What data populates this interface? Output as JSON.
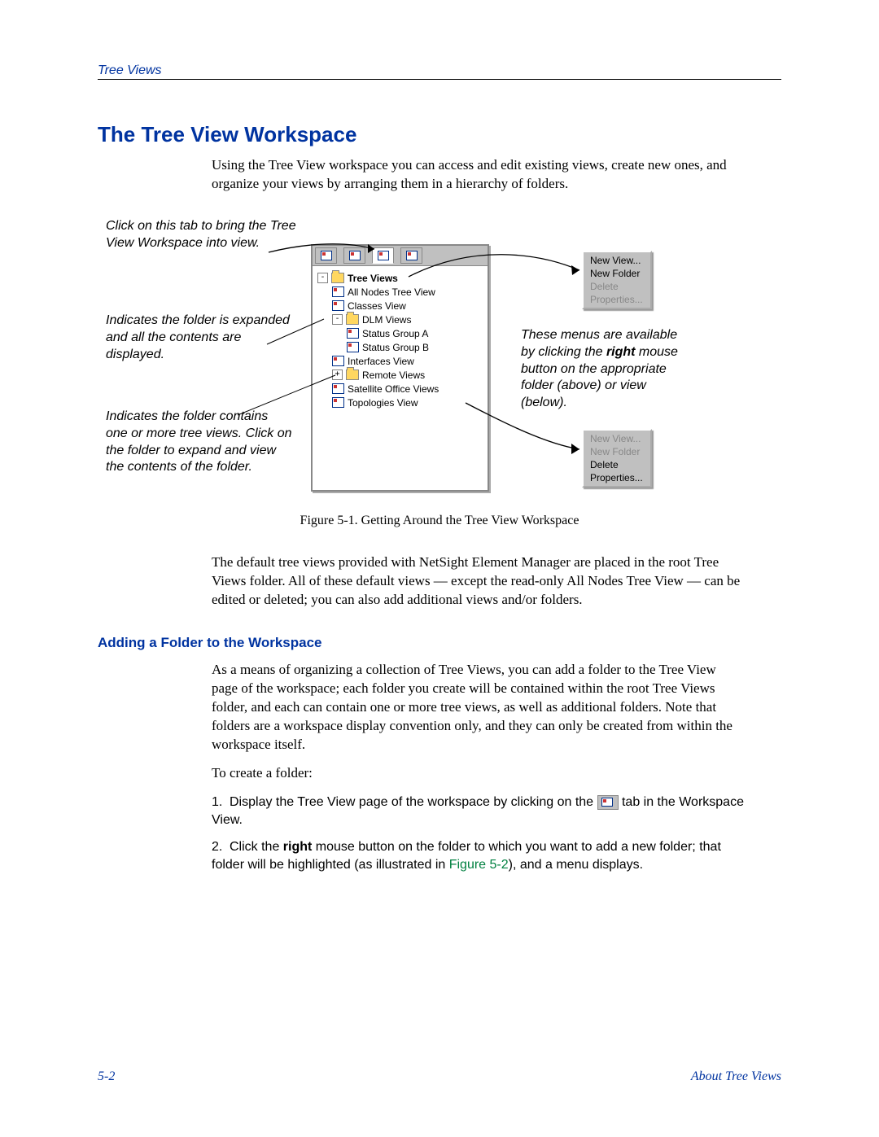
{
  "header": {
    "label": "Tree Views"
  },
  "title": "The Tree View Workspace",
  "intro": "Using the Tree View workspace you can access and edit existing views, create new ones, and organize your views by arranging them in a hierarchy of folders.",
  "notes": {
    "left1": "Click on this tab to bring the Tree View Workspace into view.",
    "left2": "Indicates the folder is expanded and all the contents are displayed.",
    "left3": "Indicates the folder contains one or more tree views. Click on the folder to expand and view the contents of the folder.",
    "right1_a": "These menus are available by clicking the ",
    "right1_bold": "right",
    "right1_b": " mouse button on the appropriate folder (above) or view (below)."
  },
  "tree": {
    "root": "Tree Views",
    "items": [
      {
        "label": "All Nodes Tree View",
        "type": "view"
      },
      {
        "label": "Classes View",
        "type": "view"
      },
      {
        "label": "DLM Views",
        "type": "folder",
        "expanded": true,
        "children": [
          {
            "label": "Status Group A",
            "type": "view"
          },
          {
            "label": "Status Group B",
            "type": "view"
          }
        ]
      },
      {
        "label": "Interfaces View",
        "type": "view"
      },
      {
        "label": "Remote Views",
        "type": "folder",
        "expanded": false
      },
      {
        "label": "Satellite Office Views",
        "type": "view"
      },
      {
        "label": "Topologies View",
        "type": "view"
      }
    ]
  },
  "menu_folder": {
    "items": [
      {
        "label": "New View...",
        "disabled": false
      },
      {
        "label": "New Folder",
        "disabled": false
      },
      {
        "label": "Delete",
        "disabled": true
      },
      {
        "label": "Properties...",
        "disabled": true
      }
    ]
  },
  "menu_view": {
    "items": [
      {
        "label": "New View...",
        "disabled": true
      },
      {
        "label": "New Folder",
        "disabled": true
      },
      {
        "label": "Delete",
        "disabled": false
      },
      {
        "label": "Properties...",
        "disabled": false
      }
    ]
  },
  "figure_caption": "Figure 5-1. Getting Around the Tree View Workspace",
  "para2": "The default tree views provided with NetSight Element Manager are placed in the root Tree Views folder. All of these default views — except the read-only All Nodes Tree View — can be edited or deleted; you can also add additional views and/or folders.",
  "subhead": "Adding a Folder to the Workspace",
  "para3": "As a means of organizing a collection of Tree Views, you can add a folder to the Tree View page of the workspace; each folder you create will be contained within the root Tree Views folder, and each can contain one or more tree views, as well as additional folders. Note that folders are a workspace display convention only, and they can only be created from within the workspace itself.",
  "para4": "To create a folder:",
  "steps": {
    "s1_a": "Display the Tree View page of the workspace by clicking on the ",
    "s1_b": " tab in the Workspace View.",
    "s2_a": "Click the ",
    "s2_bold": "right",
    "s2_b": " mouse button on the folder to which you want to add a new folder; that folder will be highlighted (as illustrated in ",
    "s2_ref": "Figure 5-2",
    "s2_c": "), and a menu displays."
  },
  "footer": {
    "page": "5-2",
    "section": "About Tree Views"
  }
}
